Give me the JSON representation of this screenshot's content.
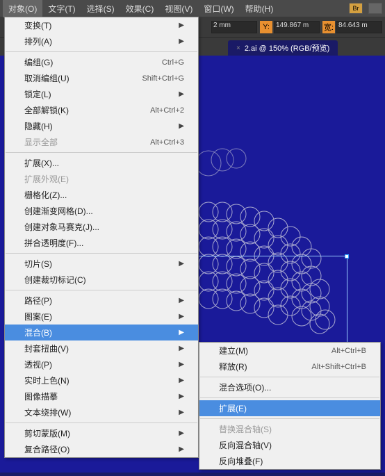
{
  "menubar": {
    "items": [
      "对象(O)",
      "文字(T)",
      "选择(S)",
      "效果(C)",
      "视图(V)",
      "窗口(W)",
      "帮助(H)"
    ]
  },
  "toolbar": {
    "x": {
      "label": "",
      "value": "2 mm"
    },
    "y": {
      "label": "Y:",
      "value": "149.867 m"
    },
    "w": {
      "label": "宽:",
      "value": "84.643 m"
    }
  },
  "tabs": {
    "active": {
      "label": "2.ai @ 150% (RGB/预览)"
    }
  },
  "menu": {
    "items": [
      {
        "label": "变换(T)",
        "arrow": true
      },
      {
        "label": "排列(A)",
        "arrow": true
      },
      {
        "sep": true
      },
      {
        "label": "编组(G)",
        "shortcut": "Ctrl+G"
      },
      {
        "label": "取消编组(U)",
        "shortcut": "Shift+Ctrl+G"
      },
      {
        "label": "锁定(L)",
        "arrow": true
      },
      {
        "label": "全部解锁(K)",
        "shortcut": "Alt+Ctrl+2"
      },
      {
        "label": "隐藏(H)",
        "arrow": true
      },
      {
        "label": "显示全部",
        "shortcut": "Alt+Ctrl+3",
        "disabled": true
      },
      {
        "sep": true
      },
      {
        "label": "扩展(X)..."
      },
      {
        "label": "扩展外观(E)",
        "disabled": true
      },
      {
        "label": "栅格化(Z)..."
      },
      {
        "label": "创建渐变网格(D)..."
      },
      {
        "label": "创建对象马赛克(J)..."
      },
      {
        "label": "拼合透明度(F)..."
      },
      {
        "sep": true
      },
      {
        "label": "切片(S)",
        "arrow": true
      },
      {
        "label": "创建裁切标记(C)"
      },
      {
        "sep": true
      },
      {
        "label": "路径(P)",
        "arrow": true
      },
      {
        "label": "图案(E)",
        "arrow": true
      },
      {
        "label": "混合(B)",
        "arrow": true,
        "hover": true
      },
      {
        "label": "封套扭曲(V)",
        "arrow": true
      },
      {
        "label": "透视(P)",
        "arrow": true
      },
      {
        "label": "实时上色(N)",
        "arrow": true
      },
      {
        "label": "图像描摹",
        "arrow": true
      },
      {
        "label": "文本绕排(W)",
        "arrow": true
      },
      {
        "sep": true
      },
      {
        "label": "剪切蒙版(M)",
        "arrow": true
      },
      {
        "label": "复合路径(O)",
        "arrow": true
      }
    ]
  },
  "submenu": {
    "items": [
      {
        "label": "建立(M)",
        "shortcut": "Alt+Ctrl+B"
      },
      {
        "label": "释放(R)",
        "shortcut": "Alt+Shift+Ctrl+B"
      },
      {
        "sep": true
      },
      {
        "label": "混合选项(O)..."
      },
      {
        "sep": true
      },
      {
        "label": "扩展(E)",
        "hover": true
      },
      {
        "sep": true
      },
      {
        "label": "替换混合轴(S)",
        "disabled": true
      },
      {
        "label": "反向混合轴(V)"
      },
      {
        "label": "反向堆叠(F)"
      }
    ]
  }
}
